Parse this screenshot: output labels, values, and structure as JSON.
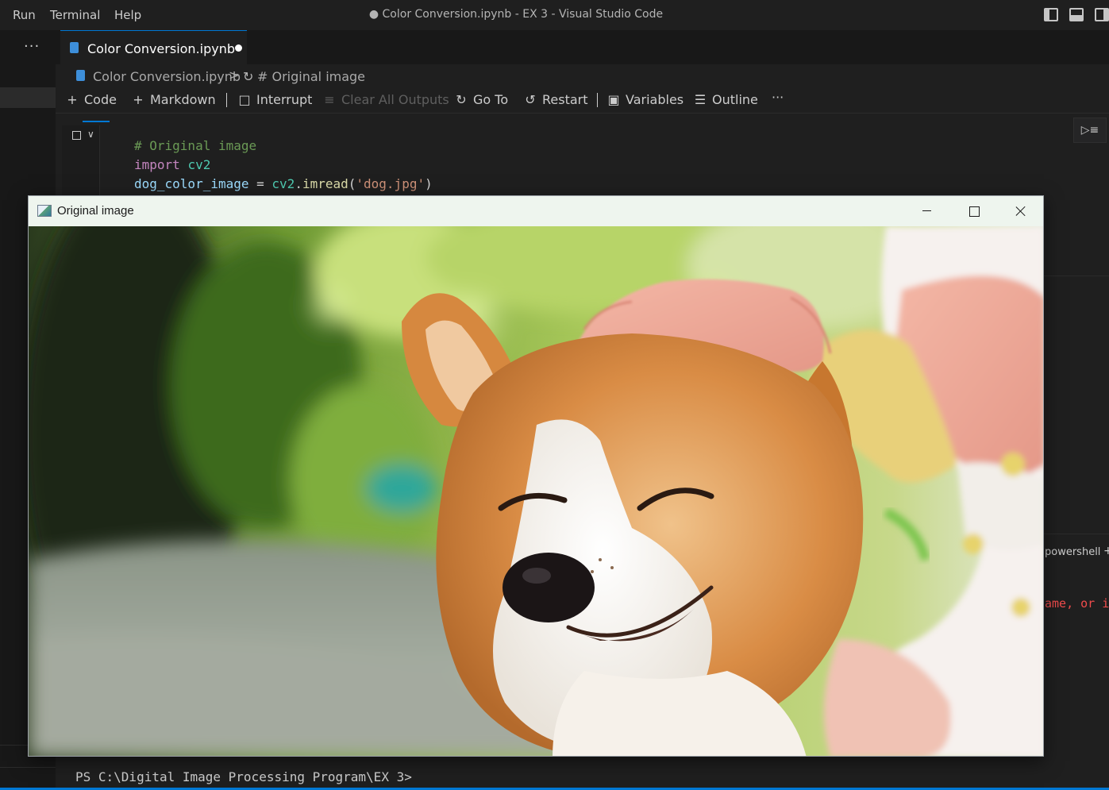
{
  "menu": {
    "run": "Run",
    "terminal": "Terminal",
    "help": "Help"
  },
  "window_title": "● Color Conversion.ipynb - EX 3 - Visual Studio Code",
  "activity": {
    "more": "···"
  },
  "tab": {
    "filename": "Color Conversion.ipynb",
    "dirty": true
  },
  "breadcrumb": {
    "file": "Color Conversion.ipynb",
    "separator": ">",
    "section": "# Original image"
  },
  "toolbar": {
    "code": "Code",
    "markdown": "Markdown",
    "interrupt": "Interrupt",
    "clear_all_outputs": "Clear All Outputs",
    "go_to": "Go To",
    "restart": "Restart",
    "variables": "Variables",
    "outline": "Outline",
    "more": "···"
  },
  "cell": {
    "lines": [
      [
        {
          "t": "# Original image",
          "c": "comment"
        }
      ],
      [
        {
          "t": "import",
          "c": "kw"
        },
        {
          "t": " ",
          "c": "op"
        },
        {
          "t": "cv2",
          "c": "mod"
        }
      ],
      [
        {
          "t": "dog_color_image",
          "c": "var"
        },
        {
          "t": " = ",
          "c": "op"
        },
        {
          "t": "cv2",
          "c": "mod"
        },
        {
          "t": ".",
          "c": "op"
        },
        {
          "t": "imread",
          "c": "fn"
        },
        {
          "t": "(",
          "c": "op"
        },
        {
          "t": "'dog.jpg'",
          "c": "str"
        },
        {
          "t": ")",
          "c": "op"
        }
      ]
    ]
  },
  "panel": {
    "terminal_tab": "powershell",
    "plus": "+",
    "error_fragment": "ame, or if",
    "prompt": "PS C:\\Digital Image Processing Program\\EX 3>"
  },
  "image_window": {
    "title": "Original image",
    "subject": "corgi dog being petted by a child's hand, outdoors"
  },
  "colors": {
    "editor_bg": "#1f1f1f",
    "accent": "#0078d4",
    "comment": "#6a9955",
    "keyword": "#c586c0",
    "string": "#ce9178",
    "error": "#f14c4c"
  }
}
